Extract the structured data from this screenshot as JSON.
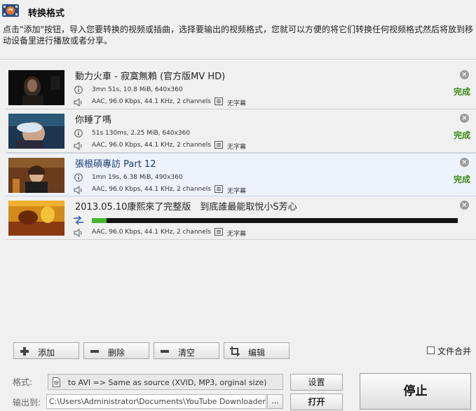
{
  "header": {
    "title": "转换格式",
    "description": "点击\"添加\"按钮，导入您要转换的视频或插曲，选择要输出的视频格式，您就可以方便的将它们转换任何视频格式然后将放到移动设备里进行播放或者分享。"
  },
  "items": [
    {
      "title": "動力火車 - 寂寞無賴 (官方版MV HD)",
      "video_info": "3mn 51s, 10.8 MiB, 640x360",
      "audio_info": "AAC, 96.0 Kbps, 44.1 KHz, 2 channels",
      "subtitle": "无字幕",
      "status": "完成"
    },
    {
      "title": "你睡了嗎",
      "video_info": "51s 130ms, 2.25 MiB, 640x360",
      "audio_info": "AAC, 96.0 Kbps, 44.1 KHz, 2 channels",
      "subtitle": "无字幕",
      "status": "完成"
    },
    {
      "title": "張根碩專訪 Part 12",
      "video_info": "1mn 19s, 6.38 MiB, 490x360",
      "audio_info": "AAC, 96.0 Kbps, 44.1 KHz, 2 channels",
      "subtitle": "无字幕",
      "status": "完成"
    },
    {
      "title": "2013.05.10康熙來了完整版　到底誰最能取悅小S芳心",
      "audio_info": "AAC, 96.0 Kbps, 44.1 KHz, 2 channels",
      "subtitle": "无字幕",
      "progress": 0.04
    }
  ],
  "toolbar": {
    "add": "添加",
    "delete": "删除",
    "clear": "清空",
    "edit": "编辑",
    "merge": "文件合并"
  },
  "bottom": {
    "format_label": "格式:",
    "format_value": "to AVI => Same as source (XVID, MP3, orginal size)",
    "output_label": "输出到:",
    "output_value": "C:\\Users\\Administrator\\Documents\\YouTube Downloader",
    "browse": "...",
    "settings": "设置",
    "open": "打开",
    "stop": "停止"
  },
  "colors": {
    "done": "#3d8a1c",
    "progress": "#43b52b"
  }
}
